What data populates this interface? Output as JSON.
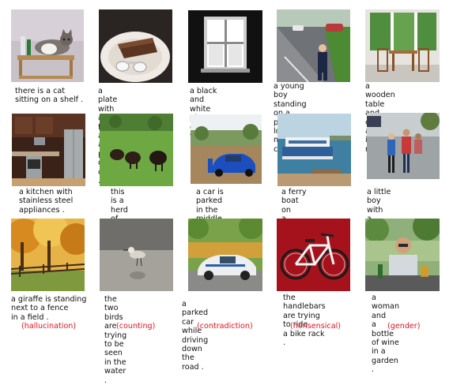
{
  "rows": [
    {
      "items": [
        {
          "caption": "there is a cat\nsitting on a shelf .",
          "image": "cat on a wall shelf with toiletries"
        },
        {
          "caption": "a plate with a fork\nand a piece of cake .",
          "image": "plate with chocolate cake slice and fork"
        },
        {
          "caption": "a black and white\nphoto of a window .",
          "image": "black and white window"
        },
        {
          "caption": "a young boy standing\non a parking lot\nnext to cars .",
          "image": "boy on parking lot with cars"
        },
        {
          "caption": "a wooden table\nand chairs arranged\nin a room .",
          "image": "wooden table and chairs by windows"
        }
      ]
    },
    {
      "items": [
        {
          "caption": "a kitchen with\nstainless steel\nappliances .",
          "image": "kitchen with steel appliances"
        },
        {
          "caption": "this is a herd\nof cattle out\nin the field .",
          "image": "bison on green field"
        },
        {
          "caption": "a car is parked\nin the middle\nof nowhere .",
          "image": "blue car on dirt road"
        },
        {
          "caption": "a ferry boat on\na marina with a\ngroup of people .",
          "image": "ferry boat on water"
        },
        {
          "caption": "a little boy with\na bunch of friends\non the street .",
          "image": "kids on a street"
        }
      ]
    },
    {
      "items": [
        {
          "caption": "a giraffe is standing\nnext to a fence\nin a field .",
          "label": "(hallucination)",
          "image": "autumn trees along a fence"
        },
        {
          "caption": "the two birds are\ntrying to be seen\nin the water .",
          "label": "(counting)",
          "image": "bird on beach with reflection"
        },
        {
          "caption": "a parked car while\ndriving down the road .",
          "label": "(contradiction)",
          "image": "white rally car on road"
        },
        {
          "caption": "the handlebars\nare trying to ride\na bike rack .",
          "label": "(nonsensical)",
          "image": "white bicycle on red background"
        },
        {
          "caption": "a woman and\na bottle of wine\nin a garden .",
          "label": "(gender)",
          "image": "man at table with beer"
        }
      ]
    }
  ],
  "colors": {
    "label_red": "#e0141e"
  }
}
